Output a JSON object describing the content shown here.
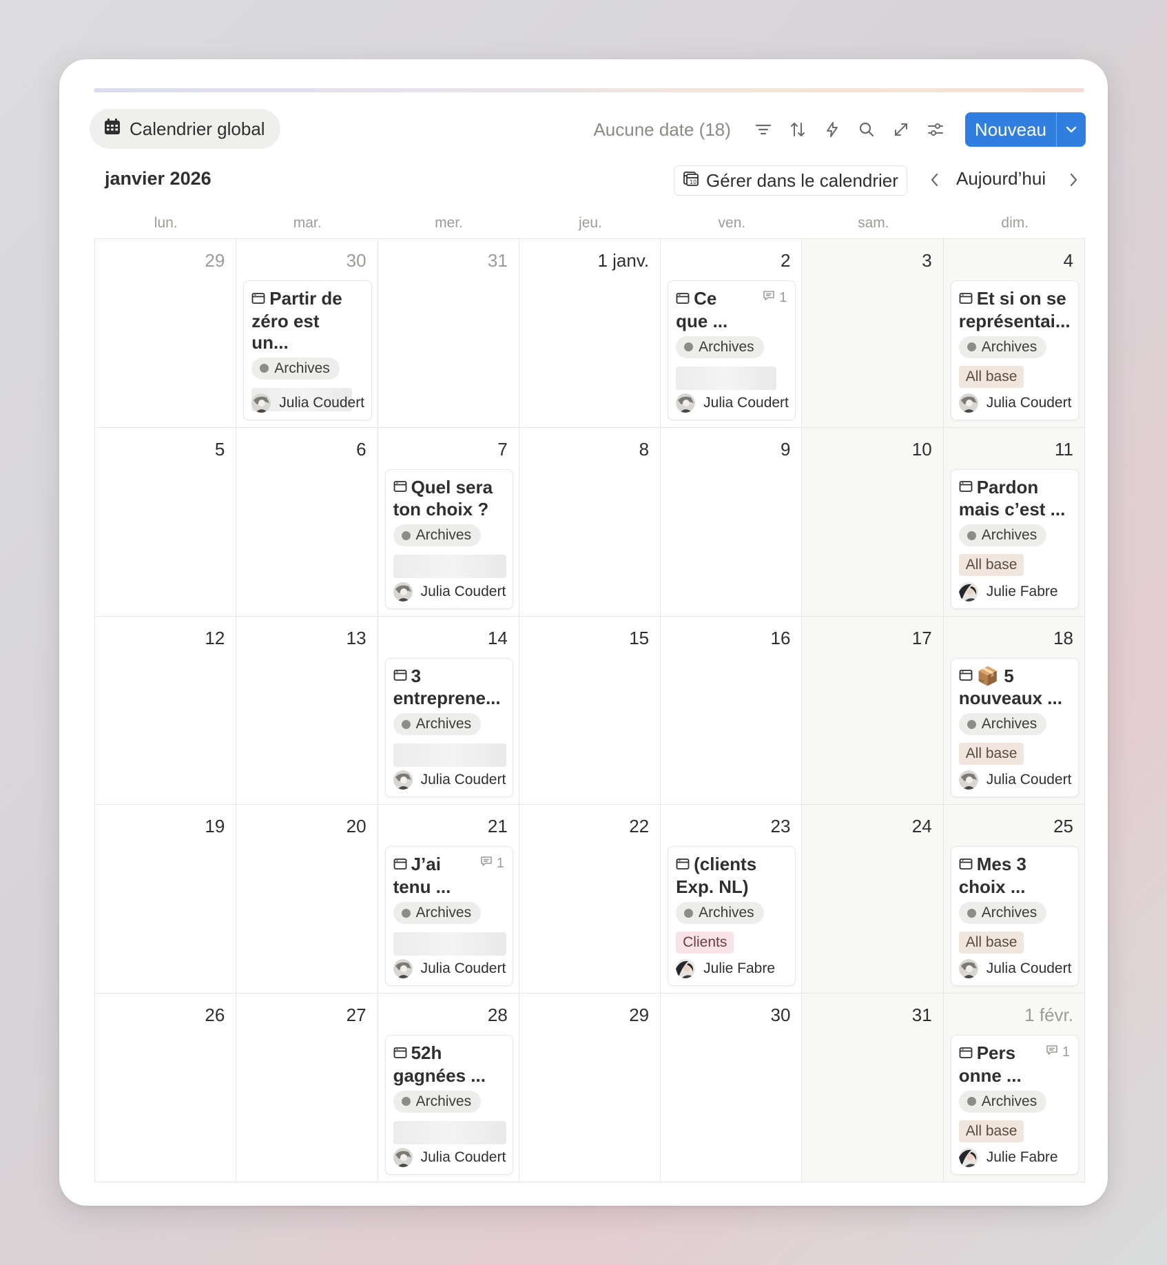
{
  "view": {
    "label": "Calendrier global",
    "icon": "calendar-icon"
  },
  "toolbar": {
    "no_date": "Aucune date (18)",
    "icons": [
      "filter-icon",
      "sort-icon",
      "automation-icon",
      "search-icon",
      "expand-icon",
      "settings-icon"
    ],
    "new_label": "Nouveau"
  },
  "header": {
    "month": "janvier 2026",
    "manage": "Gérer dans le calendrier",
    "today": "Aujourd’hui"
  },
  "weekdays": [
    "lun.",
    "mar.",
    "mer.",
    "jeu.",
    "ven.",
    "sam.",
    "dim."
  ],
  "days": [
    {
      "label": "29",
      "muted": true
    },
    {
      "label": "30",
      "muted": true
    },
    {
      "label": "31",
      "muted": true
    },
    {
      "label": "1 janv.",
      "muted": false
    },
    {
      "label": "2",
      "muted": false
    },
    {
      "label": "3",
      "muted": false
    },
    {
      "label": "4",
      "muted": false
    },
    {
      "label": "5",
      "muted": false
    },
    {
      "label": "6",
      "muted": false
    },
    {
      "label": "7",
      "muted": false
    },
    {
      "label": "8",
      "muted": false
    },
    {
      "label": "9",
      "muted": false
    },
    {
      "label": "10",
      "muted": false
    },
    {
      "label": "11",
      "muted": false
    },
    {
      "label": "12",
      "muted": false
    },
    {
      "label": "13",
      "muted": false
    },
    {
      "label": "14",
      "muted": false
    },
    {
      "label": "15",
      "muted": false
    },
    {
      "label": "16",
      "muted": false
    },
    {
      "label": "17",
      "muted": false
    },
    {
      "label": "18",
      "muted": false
    },
    {
      "label": "19",
      "muted": false
    },
    {
      "label": "20",
      "muted": false
    },
    {
      "label": "21",
      "muted": false
    },
    {
      "label": "22",
      "muted": false
    },
    {
      "label": "23",
      "muted": false
    },
    {
      "label": "24",
      "muted": false
    },
    {
      "label": "25",
      "muted": false
    },
    {
      "label": "26",
      "muted": false
    },
    {
      "label": "27",
      "muted": false
    },
    {
      "label": "28",
      "muted": false
    },
    {
      "label": "29",
      "muted": false
    },
    {
      "label": "30",
      "muted": false
    },
    {
      "label": "31",
      "muted": false
    },
    {
      "label": "1 févr.",
      "muted": true
    }
  ],
  "events": {
    "1": {
      "title": "Partir de zéro est un...",
      "status": "Archives",
      "tag": null,
      "blurred": true,
      "person": "Julia Coudert",
      "avatar": "julia",
      "comments": null
    },
    "4": {
      "title": "Ce que ...",
      "status": "Archives",
      "tag": null,
      "blurred": true,
      "person": "Julia Coudert",
      "avatar": "julia",
      "comments": "1"
    },
    "6": {
      "title": "Et si on se représentai...",
      "status": "Archives",
      "tag": "All base",
      "tag_kind": "allbase",
      "blurred": false,
      "person": "Julia Coudert",
      "avatar": "julia",
      "comments": null
    },
    "9": {
      "title": "Quel sera ton choix ?",
      "status": "Archives",
      "tag": null,
      "blurred": true,
      "person": "Julia Coudert",
      "avatar": "julia",
      "comments": null
    },
    "13": {
      "title": "Pardon mais c’est ...",
      "status": "Archives",
      "tag": "All base",
      "tag_kind": "allbase",
      "blurred": false,
      "person": "Julie Fabre",
      "avatar": "julie",
      "comments": null
    },
    "16": {
      "title": "3 entreprene...",
      "status": "Archives",
      "tag": null,
      "blurred": true,
      "person": "Julia Coudert",
      "avatar": "julia",
      "comments": null
    },
    "20": {
      "title": "📦 5 nouveaux ...",
      "status": "Archives",
      "tag": "All base",
      "tag_kind": "allbase",
      "blurred": false,
      "person": "Julia Coudert",
      "avatar": "julia",
      "comments": null
    },
    "23": {
      "title": "J’ai tenu ...",
      "status": "Archives",
      "tag": null,
      "blurred": true,
      "person": "Julia Coudert",
      "avatar": "julia",
      "comments": "1"
    },
    "25": {
      "title": "(clients Exp. NL)",
      "status": "Archives",
      "tag": "Clients",
      "tag_kind": "clients",
      "blurred": false,
      "person": "Julie Fabre",
      "avatar": "julie",
      "comments": null
    },
    "27": {
      "title": "Mes 3 choix ...",
      "status": "Archives",
      "tag": "All base",
      "tag_kind": "allbase",
      "blurred": false,
      "person": "Julia Coudert",
      "avatar": "julia",
      "comments": null
    },
    "30": {
      "title": "52h gagnées ...",
      "status": "Archives",
      "tag": null,
      "blurred": true,
      "person": "Julia Coudert",
      "avatar": "julia",
      "comments": null
    },
    "34": {
      "title": "Pers onne ...",
      "status": "Archives",
      "tag": "All base",
      "tag_kind": "allbase",
      "blurred": false,
      "person": "Julie Fabre",
      "avatar": "julie",
      "comments": "1"
    }
  },
  "colors": {
    "accent": "#2f7ee0",
    "status_dot": "#8c8c89",
    "all_base": "#f1e6de",
    "clients": "#f8e4e8",
    "weekend": "#f8f8f7"
  }
}
